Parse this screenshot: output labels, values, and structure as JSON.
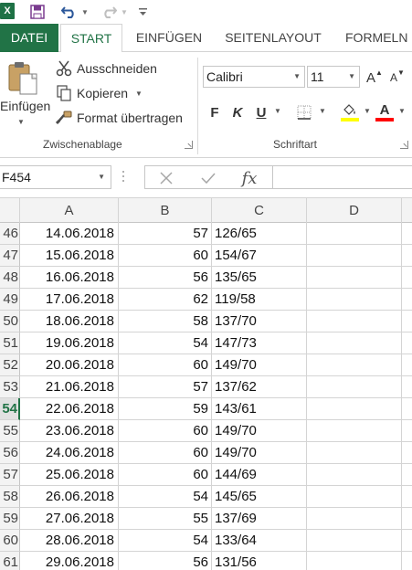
{
  "quick_access": {
    "app_logo": "X",
    "icons": [
      "excel-logo-icon",
      "save-icon",
      "undo-icon",
      "redo-icon",
      "customize-toolbar-icon"
    ]
  },
  "tabs": [
    {
      "label": "DATEI",
      "selected": false
    },
    {
      "label": "START",
      "selected": true
    },
    {
      "label": "EINFÜGEN",
      "selected": false
    },
    {
      "label": "SEITENLAYOUT",
      "selected": false
    },
    {
      "label": "FORMELN",
      "selected": false
    }
  ],
  "clipboard": {
    "paste_label": "Einfügen",
    "cut_label": "Ausschneiden",
    "copy_label": "Kopieren",
    "format_painter_label": "Format übertragen",
    "group_label": "Zwischenablage"
  },
  "font": {
    "font_name": "Calibri",
    "font_size": "11",
    "bold_label": "F",
    "italic_label": "K",
    "underline_label": "U",
    "font_color_label": "A",
    "grow_label": "A",
    "shrink_label": "A",
    "group_label": "Schriftart",
    "highlight_color": "#ffff00",
    "font_color": "#ff0000"
  },
  "formula_bar": {
    "name_box": "F454",
    "fx_label": "fx",
    "formula": ""
  },
  "columns": [
    "A",
    "B",
    "C",
    "D"
  ],
  "rows": [
    {
      "num": "46",
      "a": "14.06.2018",
      "b": "57",
      "c": "126/65"
    },
    {
      "num": "47",
      "a": "15.06.2018",
      "b": "60",
      "c": "154/67"
    },
    {
      "num": "48",
      "a": "16.06.2018",
      "b": "56",
      "c": "135/65"
    },
    {
      "num": "49",
      "a": "17.06.2018",
      "b": "62",
      "c": "119/58"
    },
    {
      "num": "50",
      "a": "18.06.2018",
      "b": "58",
      "c": "137/70"
    },
    {
      "num": "51",
      "a": "19.06.2018",
      "b": "54",
      "c": "147/73"
    },
    {
      "num": "52",
      "a": "20.06.2018",
      "b": "60",
      "c": "149/70"
    },
    {
      "num": "53",
      "a": "21.06.2018",
      "b": "57",
      "c": "137/62"
    },
    {
      "num": "54",
      "a": "22.06.2018",
      "b": "59",
      "c": "143/61",
      "active": true
    },
    {
      "num": "55",
      "a": "23.06.2018",
      "b": "60",
      "c": "149/70"
    },
    {
      "num": "56",
      "a": "24.06.2018",
      "b": "60",
      "c": "149/70"
    },
    {
      "num": "57",
      "a": "25.06.2018",
      "b": "60",
      "c": "144/69"
    },
    {
      "num": "58",
      "a": "26.06.2018",
      "b": "54",
      "c": "145/65"
    },
    {
      "num": "59",
      "a": "27.06.2018",
      "b": "55",
      "c": "137/69"
    },
    {
      "num": "60",
      "a": "28.06.2018",
      "b": "54",
      "c": "133/64"
    },
    {
      "num": "61",
      "a": "29.06.2018",
      "b": "56",
      "c": "131/56"
    }
  ],
  "colors": {
    "excel_green": "#217346",
    "header_bg": "#f3f3f3",
    "gridline": "#d4d4d4"
  }
}
